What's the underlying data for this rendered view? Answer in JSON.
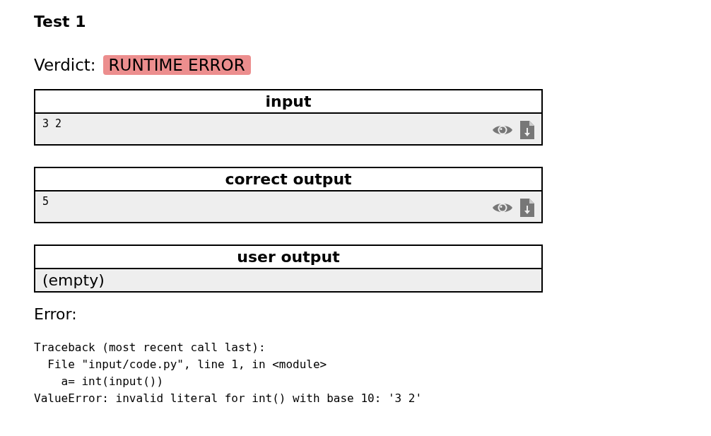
{
  "title": "Test 1",
  "verdict": {
    "label": "Verdict:",
    "value": "RUNTIME ERROR",
    "kind": "runtime_error"
  },
  "blocks": [
    {
      "title": "input",
      "kind": "data",
      "content": "3 2"
    },
    {
      "title": "correct output",
      "kind": "data",
      "content": "5"
    },
    {
      "title": "user output",
      "kind": "empty",
      "content": "(empty)"
    }
  ],
  "error": {
    "label": "Error:",
    "traceback": "Traceback (most recent call last):\n  File \"input/code.py\", line 1, in <module>\n    a= int(input())\nValueError: invalid literal for int() with base 10: '3 2'"
  }
}
